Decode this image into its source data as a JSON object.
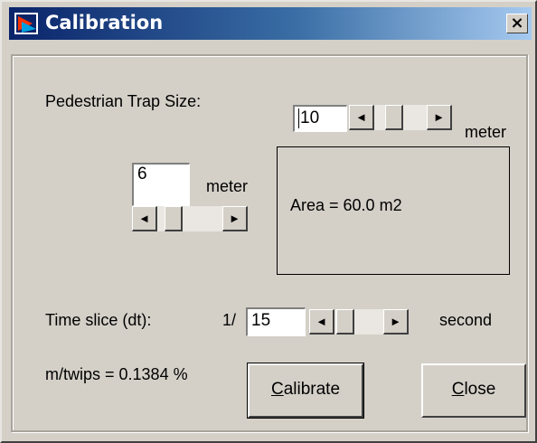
{
  "window": {
    "title": "Calibration",
    "close_glyph": "×"
  },
  "trap": {
    "label": "Pedestrian Trap Size:",
    "length_value": "10",
    "length_unit": "meter",
    "width_value": "6",
    "width_unit": "meter",
    "area_text": "Area = 60.0 m2"
  },
  "time": {
    "label": "Time slice (dt):",
    "prefix": "1/",
    "value": "15",
    "unit": "second"
  },
  "ratio_text": "m/twips = 0.1384 %",
  "buttons": {
    "calibrate_first": "C",
    "calibrate_rest": "alibrate",
    "close_first": "C",
    "close_rest": "lose"
  },
  "scroll_glyphs": {
    "left": "◄",
    "right": "►"
  }
}
